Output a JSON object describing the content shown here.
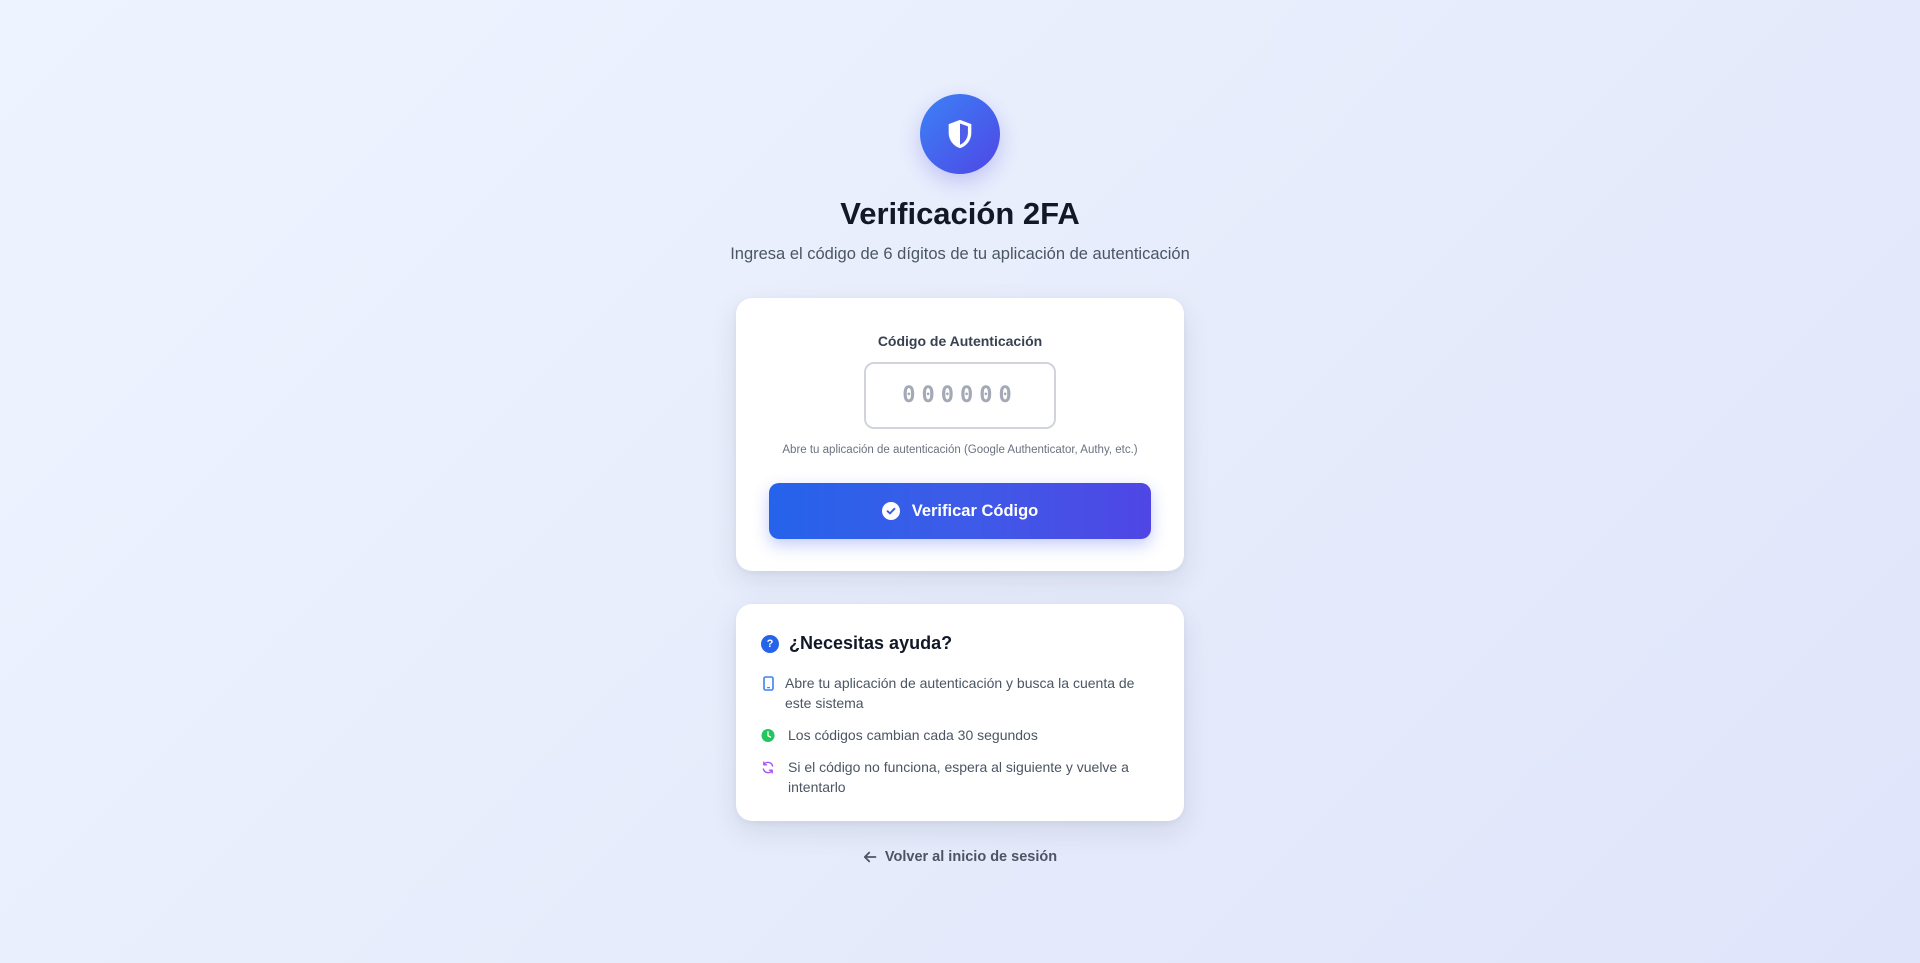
{
  "header": {
    "icon": "shield-icon",
    "title": "Verificación 2FA",
    "subtitle": "Ingresa el código de 6 dígitos de tu aplicación de autenticación"
  },
  "verify_card": {
    "label": "Código de Autenticación",
    "input_placeholder": "000000",
    "input_value": "",
    "hint": "Abre tu aplicación de autenticación (Google Authenticator, Authy, etc.)",
    "button_label": "Verificar Código",
    "button_icon": "check-circle-icon"
  },
  "help_card": {
    "title": "¿Necesitas ayuda?",
    "title_icon": "question-circle-icon",
    "items": [
      {
        "icon": "smartphone-icon",
        "icon_color": "#3b82f6",
        "text": "Abre tu aplicación de autenticación y busca la cuenta de este sistema"
      },
      {
        "icon": "clock-icon",
        "icon_color": "#22c55e",
        "text": "Los códigos cambian cada 30 segundos"
      },
      {
        "icon": "refresh-icon",
        "icon_color": "#a855f7",
        "text": "Si el código no funciona, espera al siguiente y vuelve a intentarlo"
      }
    ]
  },
  "footer": {
    "back_label": "Volver al inicio de sesión",
    "back_icon": "arrow-left-icon"
  },
  "colors": {
    "primary": "#2563eb",
    "accent": "#4f46e5",
    "text_dark": "#111827",
    "text_muted": "#4b5563"
  }
}
